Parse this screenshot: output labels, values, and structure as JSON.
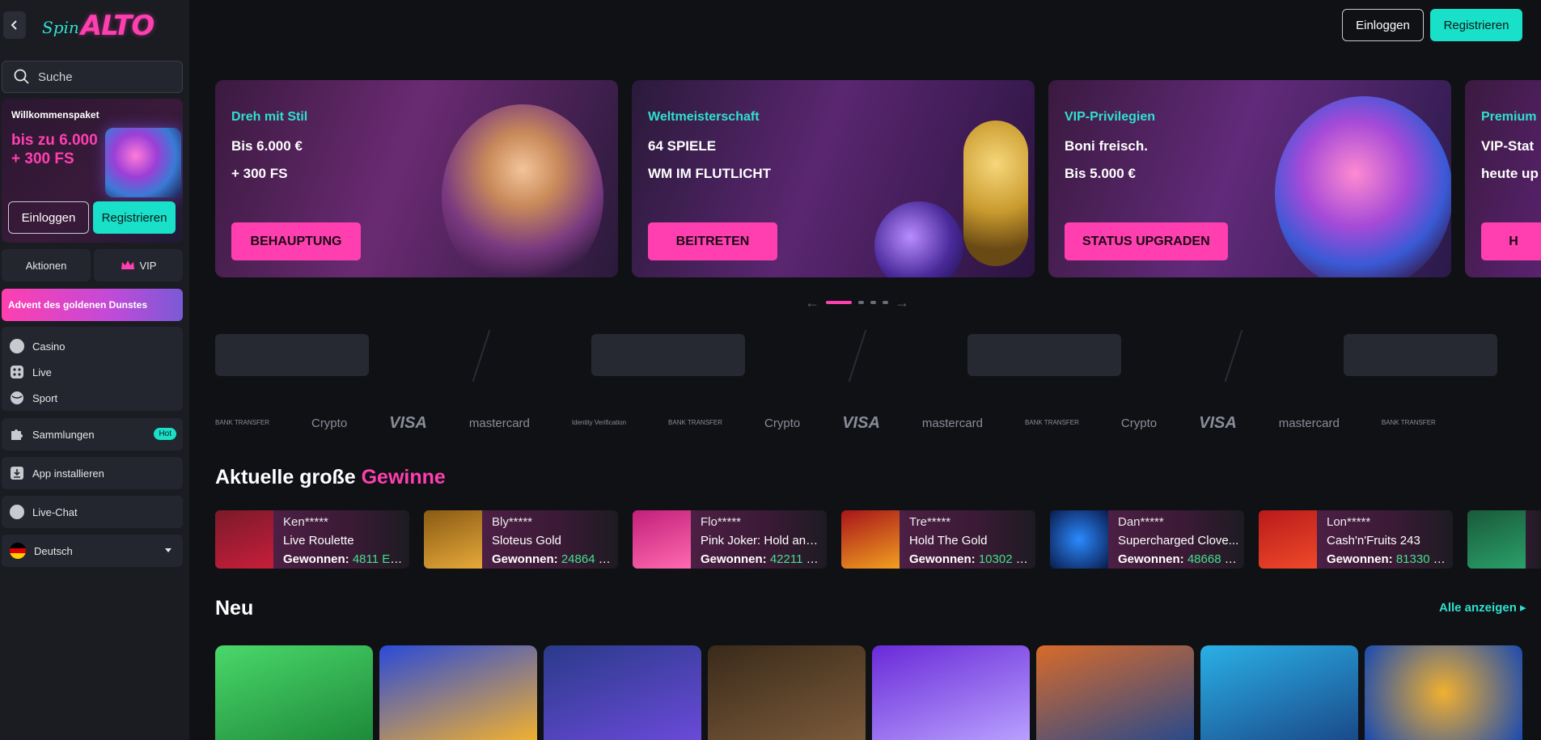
{
  "sidebar": {
    "search_placeholder": "Suche",
    "welcome": {
      "title": "Willkommenspaket",
      "amount": "bis zu 6.000 + 300 FS",
      "login": "Einloggen",
      "register": "Registrieren"
    },
    "tabs": {
      "aktionen": "Aktionen",
      "vip": "VIP"
    },
    "advent": "Advent des goldenen Dunstes",
    "nav": {
      "casino": "Casino",
      "live": "Live",
      "sport": "Sport"
    },
    "sammlungen": "Sammlungen",
    "hot": "Hot",
    "app": "App installieren",
    "chat": "Live-Chat",
    "language": "Deutsch"
  },
  "header": {
    "login": "Einloggen",
    "register": "Registrieren"
  },
  "banners": [
    {
      "label": "Dreh mit Stil",
      "line1": "Bis 6.000 €",
      "line2": "+ 300 FS",
      "button": "BEHAUPTUNG"
    },
    {
      "label": "Weltmeisterschaft",
      "line1": "64 SPIELE",
      "line2": "WM IM FLUTLICHT",
      "button": "BEITRETEN"
    },
    {
      "label": "VIP-Privilegien",
      "line1": "Boni freisch.",
      "line2": "Bis 5.000 €",
      "button": "STATUS UPGRADEN"
    },
    {
      "label": "Premium",
      "line1": "VIP-Stat",
      "line2": "heute up",
      "button": "H"
    }
  ],
  "payments": [
    "BANK TRANSFER",
    "Crypto",
    "VISA",
    "mastercard",
    "Identity Verification",
    "BANK TRANSFER",
    "Crypto",
    "VISA",
    "mastercard",
    "BANK TRANSFER",
    "Crypto",
    "VISA",
    "mastercard",
    "BANK TRANSFER"
  ],
  "wins": {
    "title_a": "Aktuelle große",
    "title_b": "Gewinne",
    "won_label": "Gewonnen:",
    "items": [
      {
        "user": "Ken*****",
        "game": "Live Roulette",
        "amount": "4811 EUR"
      },
      {
        "user": "Bly*****",
        "game": "Sloteus Gold",
        "amount": "24864 E..."
      },
      {
        "user": "Flo*****",
        "game": "Pink Joker: Hold and ...",
        "amount": "42211 E..."
      },
      {
        "user": "Tre*****",
        "game": "Hold The Gold",
        "amount": "10302 E..."
      },
      {
        "user": "Dan*****",
        "game": "Supercharged Clove...",
        "amount": "48668 E..."
      },
      {
        "user": "Lon*****",
        "game": "Cash'n'Fruits 243",
        "amount": "81330 E..."
      }
    ]
  },
  "neu": {
    "title": "Neu",
    "all": "Alle anzeigen"
  },
  "colors": {
    "accent_pink": "#ff3fb0",
    "accent_teal": "#19e0c9",
    "win_green": "#3fe38a"
  }
}
